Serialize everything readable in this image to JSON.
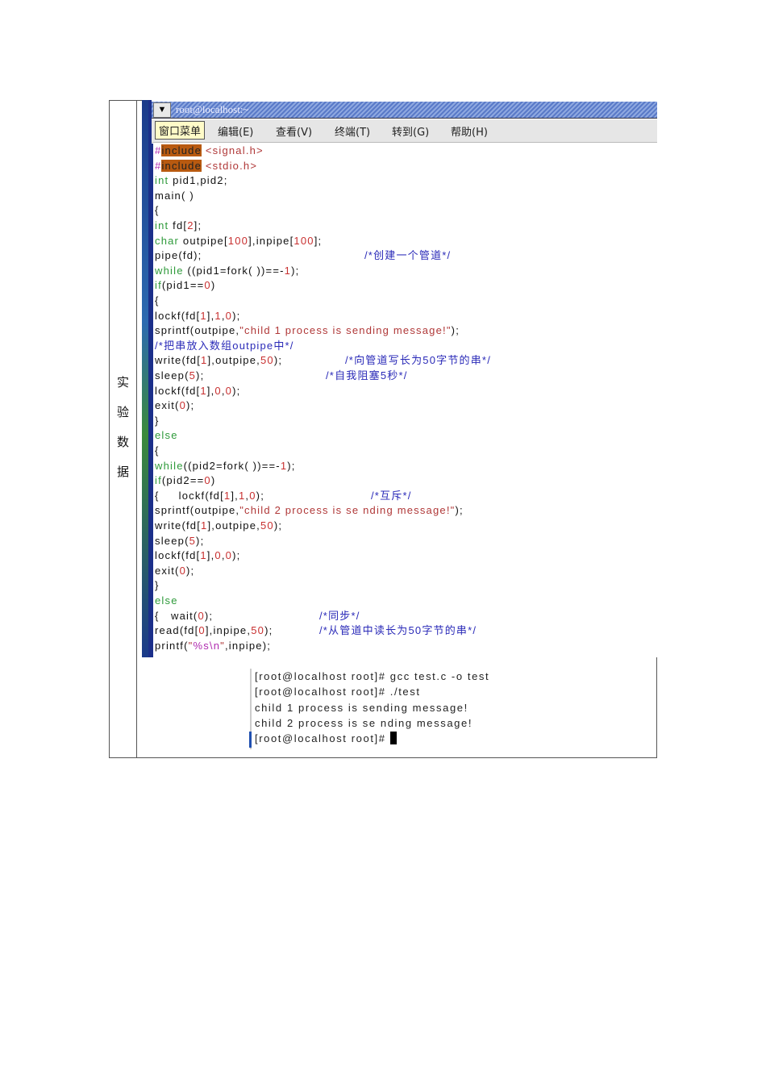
{
  "label_chars": [
    "实",
    "验",
    "数",
    "据"
  ],
  "window": {
    "title": "root@localhost:~",
    "menu": [
      "窗口菜单",
      "编辑(E)",
      "查看(V)",
      "终端(T)",
      "转到(G)",
      "帮助(H)"
    ]
  },
  "code_lines": [
    [
      {
        "t": "#",
        "c": "p"
      },
      {
        "t": "include",
        "c": "hl"
      },
      {
        "t": " <signal.h>",
        "c": "s"
      }
    ],
    [
      {
        "t": "#",
        "c": "p"
      },
      {
        "t": "include",
        "c": "hl"
      },
      {
        "t": " <stdio.h>",
        "c": "s"
      }
    ],
    [
      {
        "t": "int",
        "c": "k"
      },
      {
        "t": " pid1,pid2;",
        "c": "d"
      }
    ],
    [
      {
        "t": "main( )",
        "c": "d"
      }
    ],
    [
      {
        "t": "{",
        "c": "d"
      }
    ],
    [
      {
        "t": "int",
        "c": "k"
      },
      {
        "t": " fd[",
        "c": "d"
      },
      {
        "t": "2",
        "c": "n"
      },
      {
        "t": "];",
        "c": "d"
      }
    ],
    [
      {
        "t": "char",
        "c": "k"
      },
      {
        "t": " outpipe[",
        "c": "d"
      },
      {
        "t": "100",
        "c": "n"
      },
      {
        "t": "],inpipe[",
        "c": "d"
      },
      {
        "t": "100",
        "c": "n"
      },
      {
        "t": "];",
        "c": "d"
      }
    ],
    [
      {
        "t": "pipe(fd);",
        "c": "d"
      },
      {
        "t": "/*创建一个管道*/",
        "c": "cm"
      }
    ],
    [
      {
        "t": "while",
        "c": "k"
      },
      {
        "t": " ((pid1=fork( ))==-",
        "c": "d"
      },
      {
        "t": "1",
        "c": "n"
      },
      {
        "t": ");",
        "c": "d"
      }
    ],
    [
      {
        "t": "if",
        "c": "k"
      },
      {
        "t": "(pid1==",
        "c": "d"
      },
      {
        "t": "0",
        "c": "n"
      },
      {
        "t": ")",
        "c": "d"
      }
    ],
    [
      {
        "t": "{",
        "c": "d"
      }
    ],
    [
      {
        "t": "lockf(fd[",
        "c": "d"
      },
      {
        "t": "1",
        "c": "n"
      },
      {
        "t": "],",
        "c": "d"
      },
      {
        "t": "1",
        "c": "n"
      },
      {
        "t": ",",
        "c": "d"
      },
      {
        "t": "0",
        "c": "n"
      },
      {
        "t": ");",
        "c": "d"
      }
    ],
    [
      {
        "t": "sprintf(outpipe,",
        "c": "d"
      },
      {
        "t": "\"child 1 process is sending message!\"",
        "c": "s"
      },
      {
        "t": ");",
        "c": "d"
      }
    ],
    [
      {
        "t": "/*把串放入数组outpipe中*/",
        "c": "c"
      }
    ],
    [
      {
        "t": "write(fd[",
        "c": "d"
      },
      {
        "t": "1",
        "c": "n"
      },
      {
        "t": "],outpipe,",
        "c": "d"
      },
      {
        "t": "50",
        "c": "n"
      },
      {
        "t": ");",
        "c": "d"
      },
      {
        "t": "/*向管道写长为50字节的串*/",
        "c": "cm"
      }
    ],
    [
      {
        "t": "sleep(",
        "c": "d"
      },
      {
        "t": "5",
        "c": "n"
      },
      {
        "t": ");",
        "c": "d"
      },
      {
        "t": "/*自我阻塞5秒*/",
        "c": "cm"
      }
    ],
    [
      {
        "t": "lockf(fd[",
        "c": "d"
      },
      {
        "t": "1",
        "c": "n"
      },
      {
        "t": "],",
        "c": "d"
      },
      {
        "t": "0",
        "c": "n"
      },
      {
        "t": ",",
        "c": "d"
      },
      {
        "t": "0",
        "c": "n"
      },
      {
        "t": ");",
        "c": "d"
      }
    ],
    [
      {
        "t": "exit(",
        "c": "d"
      },
      {
        "t": "0",
        "c": "n"
      },
      {
        "t": ");",
        "c": "d"
      }
    ],
    [
      {
        "t": "}",
        "c": "d"
      }
    ],
    [
      {
        "t": "else",
        "c": "k"
      }
    ],
    [
      {
        "t": "{",
        "c": "d"
      }
    ],
    [
      {
        "t": "while",
        "c": "k"
      },
      {
        "t": "((pid2=fork( ))==-",
        "c": "d"
      },
      {
        "t": "1",
        "c": "n"
      },
      {
        "t": ");",
        "c": "d"
      }
    ],
    [
      {
        "t": "if",
        "c": "k"
      },
      {
        "t": "(pid2==",
        "c": "d"
      },
      {
        "t": "0",
        "c": "n"
      },
      {
        "t": ")",
        "c": "d"
      }
    ],
    [
      {
        "t": "{     lockf(fd[",
        "c": "d"
      },
      {
        "t": "1",
        "c": "n"
      },
      {
        "t": "],",
        "c": "d"
      },
      {
        "t": "1",
        "c": "n"
      },
      {
        "t": ",",
        "c": "d"
      },
      {
        "t": "0",
        "c": "n"
      },
      {
        "t": ");",
        "c": "d"
      },
      {
        "t": "/*互斥*/",
        "c": "cm"
      }
    ],
    [
      {
        "t": "sprintf(outpipe,",
        "c": "d"
      },
      {
        "t": "\"child 2 process is se nding message!\"",
        "c": "s"
      },
      {
        "t": ");",
        "c": "d"
      }
    ],
    [
      {
        "t": "write(fd[",
        "c": "d"
      },
      {
        "t": "1",
        "c": "n"
      },
      {
        "t": "],outpipe,",
        "c": "d"
      },
      {
        "t": "50",
        "c": "n"
      },
      {
        "t": ");",
        "c": "d"
      }
    ],
    [
      {
        "t": "sleep(",
        "c": "d"
      },
      {
        "t": "5",
        "c": "n"
      },
      {
        "t": ");",
        "c": "d"
      }
    ],
    [
      {
        "t": "lockf(fd[",
        "c": "d"
      },
      {
        "t": "1",
        "c": "n"
      },
      {
        "t": "],",
        "c": "d"
      },
      {
        "t": "0",
        "c": "n"
      },
      {
        "t": ",",
        "c": "d"
      },
      {
        "t": "0",
        "c": "n"
      },
      {
        "t": ");",
        "c": "d"
      }
    ],
    [
      {
        "t": "exit(",
        "c": "d"
      },
      {
        "t": "0",
        "c": "n"
      },
      {
        "t": ");",
        "c": "d"
      }
    ],
    [
      {
        "t": "}",
        "c": "d"
      }
    ],
    [
      {
        "t": "else",
        "c": "k"
      }
    ],
    [
      {
        "t": "{   wait(",
        "c": "d"
      },
      {
        "t": "0",
        "c": "n"
      },
      {
        "t": ");",
        "c": "d"
      },
      {
        "t": "/*同步*/",
        "c": "cm"
      }
    ],
    [
      {
        "t": "read(fd[",
        "c": "d"
      },
      {
        "t": "0",
        "c": "n"
      },
      {
        "t": "],inpipe,",
        "c": "d"
      },
      {
        "t": "50",
        "c": "n"
      },
      {
        "t": ");",
        "c": "d"
      },
      {
        "t": "/*从管道中读长为50字节的串*/",
        "c": "cm"
      }
    ],
    [
      {
        "t": "printf(",
        "c": "d"
      },
      {
        "t": "\"",
        "c": "s"
      },
      {
        "t": "%s\\n",
        "c": "p"
      },
      {
        "t": "\"",
        "c": "s"
      },
      {
        "t": ",inpipe);",
        "c": "d"
      }
    ]
  ],
  "terminal_lines": [
    "[root@localhost root]# gcc test.c -o test",
    "[root@localhost root]# ./test",
    "child 1 process is sending message!",
    "child 2 process is se nding message!",
    "[root@localhost root]# "
  ]
}
